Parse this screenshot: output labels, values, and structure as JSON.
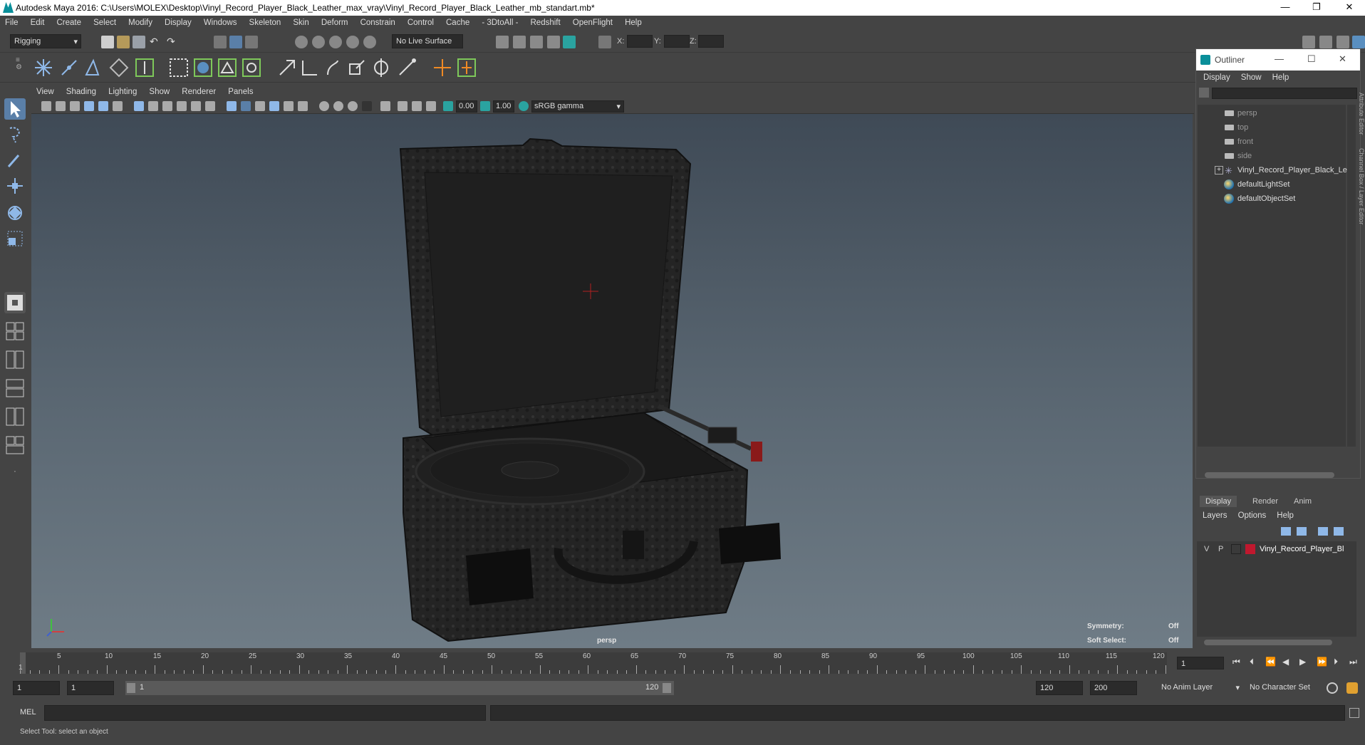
{
  "window": {
    "title": "Autodesk Maya 2016: C:\\Users\\MOLEX\\Desktop\\Vinyl_Record_Player_Black_Leather_max_vray\\Vinyl_Record_Player_Black_Leather_mb_standart.mb*",
    "minimize": "—",
    "restore": "❐",
    "close": "✕"
  },
  "menubar": [
    "File",
    "Edit",
    "Create",
    "Select",
    "Modify",
    "Display",
    "Windows",
    "Skeleton",
    "Skin",
    "Deform",
    "Constrain",
    "Control",
    "Cache",
    "- 3DtoAll -",
    "Redshift",
    "OpenFlight",
    "Help"
  ],
  "statusline": {
    "mode": "Rigging",
    "live_surface": "No Live Surface",
    "x_label": "X:",
    "y_label": "Y:",
    "z_label": "Z:"
  },
  "panel_menu": [
    "View",
    "Shading",
    "Lighting",
    "Show",
    "Renderer",
    "Panels"
  ],
  "panel_toolbar": {
    "near_value": "0.00",
    "far_value": "1.00",
    "color_space": "sRGB gamma"
  },
  "viewport": {
    "camera_label": "persp",
    "symmetry_label": "Symmetry:",
    "symmetry_value": "Off",
    "soft_select_label": "Soft Select:",
    "soft_select_value": "Off"
  },
  "outliner": {
    "title": "Outliner",
    "menus": [
      "Display",
      "Show",
      "Help"
    ],
    "items": [
      "persp",
      "top",
      "front",
      "side",
      "Vinyl_Record_Player_Black_Le",
      "defaultLightSet",
      "defaultObjectSet"
    ]
  },
  "layer_editor": {
    "tabs": [
      "Display",
      "Render",
      "Anim"
    ],
    "menus": [
      "Layers",
      "Options",
      "Help"
    ],
    "layer": {
      "v": "V",
      "p": "P",
      "name": "Vinyl_Record_Player_Bl",
      "color": "#c0182e"
    }
  },
  "timeline": {
    "ticks": [
      "5",
      "10",
      "15",
      "20",
      "25",
      "30",
      "35",
      "40",
      "45",
      "50",
      "55",
      "60",
      "65",
      "70",
      "75",
      "80",
      "85",
      "90",
      "95",
      "100",
      "105",
      "110",
      "115",
      "120"
    ],
    "start_marker": "1",
    "current_frame": "1"
  },
  "range": {
    "start": "1",
    "playback_start": "1",
    "slider_start": "1",
    "slider_end": "120",
    "playback_end": "120",
    "end": "200",
    "anim_layer": "No Anim Layer",
    "character_set": "No Character Set"
  },
  "cmdline": {
    "label": "MEL"
  },
  "helpline": {
    "text": "Select Tool: select an object"
  }
}
